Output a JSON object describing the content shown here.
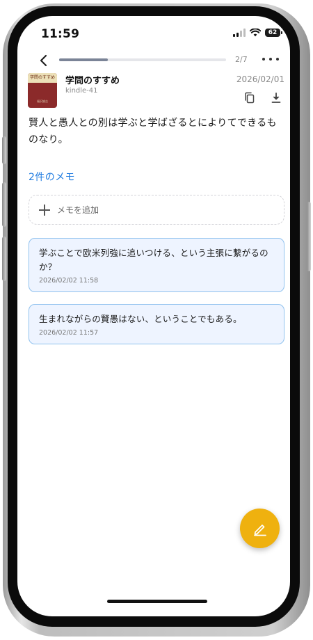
{
  "status_bar": {
    "time": "11:59",
    "battery": "62"
  },
  "nav": {
    "page_indicator": "2/7",
    "progress_fraction": 0.29
  },
  "book": {
    "title": "学問のすすめ",
    "source": "kindle-41",
    "date": "2026/02/01",
    "cover_title": "学問のすすめ",
    "cover_author": "福沢諭吉"
  },
  "highlight": {
    "text": "賢人と愚人との別は学ぶと学ばざるとによりてできるものなり。"
  },
  "memos": {
    "count_label": "2件のメモ",
    "add_label": "メモを追加",
    "items": [
      {
        "text": "学ぶことで欧米列強に追いつける、という主張に繋がるのか？",
        "time": "2026/02/02 11:58"
      },
      {
        "text": "生まれながらの賢愚はない、ということでもある。",
        "time": "2026/02/02 11:57"
      }
    ]
  },
  "icons": {
    "back": "chevron-left-icon",
    "more": "more-horizontal-icon",
    "copy": "copy-icon",
    "download": "download-icon",
    "fab": "pen-icon"
  },
  "colors": {
    "accent_blue": "#1f7be0",
    "memo_bg": "#eef4ff",
    "memo_border": "#8fc1ee",
    "fab": "#efb10f",
    "progress": "#7b8497"
  }
}
